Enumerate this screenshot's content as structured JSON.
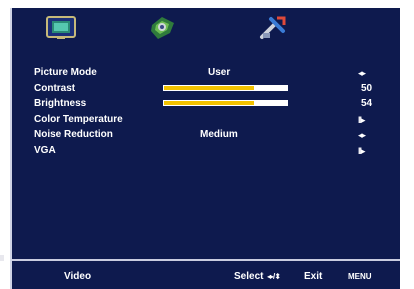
{
  "tabs": [
    {
      "name": "picture-icon",
      "selected": true
    },
    {
      "name": "settings-icon",
      "selected": false
    },
    {
      "name": "tools-icon",
      "selected": false
    }
  ],
  "menu": {
    "picture_mode": {
      "label": "Picture Mode",
      "value": "User",
      "arrow": "◂▸"
    },
    "contrast": {
      "label": "Contrast",
      "value": 50,
      "max": 100,
      "fill_fraction": 0.73
    },
    "brightness": {
      "label": "Brightness",
      "value": 54,
      "max": 100,
      "fill_fraction": 0.73
    },
    "color_temperature": {
      "label": "Color Temperature",
      "arrow": "II▸"
    },
    "noise_reduction": {
      "label": "Noise Reduction",
      "value": "Medium",
      "arrow": "◂▸"
    },
    "vga": {
      "label": "VGA",
      "arrow": "II▸"
    }
  },
  "footer": {
    "source": "Video",
    "select_label": "Select",
    "select_keys": "◂▸/⬍",
    "exit_label": "Exit",
    "menu_label": "MENU"
  },
  "colors": {
    "background": "#0e1a4e",
    "bar_fill": "#f2c200",
    "bar_track": "#ffffff",
    "text": "#ffffff"
  }
}
